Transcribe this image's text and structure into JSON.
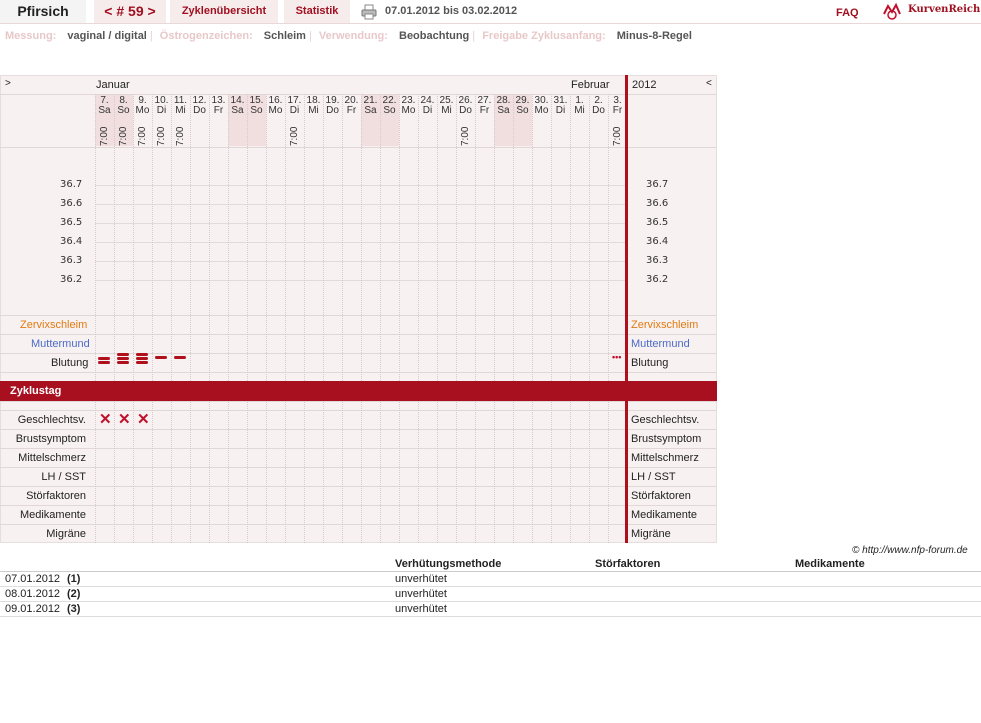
{
  "header": {
    "user": "Pfirsich",
    "cycle": "< # 59 >",
    "tab_overview": "Zyklenübersicht",
    "tab_stats": "Statistik",
    "date_range": "07.01.2012 bis 03.02.2012",
    "faq": "FAQ",
    "logo": "KurvenReich"
  },
  "settings": {
    "measure_key": "Messung:",
    "measure_val": "vaginal / digital",
    "estrogen_key": "Östrogenzeichen:",
    "estrogen_val": "Schleim",
    "usage_key": "Verwendung:",
    "usage_val": "Beobachtung",
    "release_key": "Freigabe Zyklusanfang:",
    "release_val": "Minus-8-Regel"
  },
  "chart": {
    "prev": ">",
    "next": "<",
    "month1": "Januar",
    "month2": "Februar",
    "year": "2012",
    "days": [
      {
        "d": "7.",
        "w": "Sa",
        "t": "7:00"
      },
      {
        "d": "8.",
        "w": "So",
        "t": "7:00"
      },
      {
        "d": "9.",
        "w": "Mo",
        "t": "7:00"
      },
      {
        "d": "10.",
        "w": "Di",
        "t": "7:00"
      },
      {
        "d": "11.",
        "w": "Mi",
        "t": "7:00"
      },
      {
        "d": "12.",
        "w": "Do",
        "t": ""
      },
      {
        "d": "13.",
        "w": "Fr",
        "t": ""
      },
      {
        "d": "14.",
        "w": "Sa",
        "t": ""
      },
      {
        "d": "15.",
        "w": "So",
        "t": ""
      },
      {
        "d": "16.",
        "w": "Mo",
        "t": ""
      },
      {
        "d": "17.",
        "w": "Di",
        "t": "7:00"
      },
      {
        "d": "18.",
        "w": "Mi",
        "t": ""
      },
      {
        "d": "19.",
        "w": "Do",
        "t": ""
      },
      {
        "d": "20.",
        "w": "Fr",
        "t": ""
      },
      {
        "d": "21.",
        "w": "Sa",
        "t": ""
      },
      {
        "d": "22.",
        "w": "So",
        "t": ""
      },
      {
        "d": "23.",
        "w": "Mo",
        "t": ""
      },
      {
        "d": "24.",
        "w": "Di",
        "t": ""
      },
      {
        "d": "25.",
        "w": "Mi",
        "t": ""
      },
      {
        "d": "26.",
        "w": "Do",
        "t": "7:00"
      },
      {
        "d": "27.",
        "w": "Fr",
        "t": ""
      },
      {
        "d": "28.",
        "w": "Sa",
        "t": ""
      },
      {
        "d": "29.",
        "w": "So",
        "t": ""
      },
      {
        "d": "30.",
        "w": "Mo",
        "t": ""
      },
      {
        "d": "31.",
        "w": "Di",
        "t": ""
      },
      {
        "d": "1.",
        "w": "Mi",
        "t": ""
      },
      {
        "d": "2.",
        "w": "Do",
        "t": ""
      },
      {
        "d": "3.",
        "w": "Fr",
        "t": "7:00"
      }
    ],
    "temps": [
      "36.7",
      "36.6",
      "36.5",
      "36.4",
      "36.3",
      "36.2"
    ],
    "zervix": "Zervixschleim",
    "muttermund": "Muttermund",
    "blutung": "Blutung",
    "zyklustag": "Zyklustag",
    "symptoms": [
      "Geschlechtsv.",
      "Brustsymptom",
      "Mittelschmerz",
      "LH / SST",
      "Störfaktoren",
      "Medikamente",
      "Migräne"
    ],
    "bleeding_days": [
      {
        "day": 1,
        "level": 2
      },
      {
        "day": 2,
        "level": 3
      },
      {
        "day": 3,
        "level": 3
      },
      {
        "day": 4,
        "level": 1
      },
      {
        "day": 5,
        "level": 1
      },
      {
        "day": 28,
        "level": 0
      }
    ],
    "sex_days": [
      1,
      2,
      3
    ],
    "copyright": "© http://www.nfp-forum.de"
  },
  "table": {
    "headers": [
      "Verhütungsmethode",
      "Störfaktoren",
      "Medikamente"
    ],
    "rows": [
      {
        "date": "07.01.2012",
        "num": "(1)",
        "method": "unverhütet"
      },
      {
        "date": "08.01.2012",
        "num": "(2)",
        "method": "unverhütet"
      },
      {
        "date": "09.01.2012",
        "num": "(3)",
        "method": "unverhütet"
      }
    ]
  }
}
